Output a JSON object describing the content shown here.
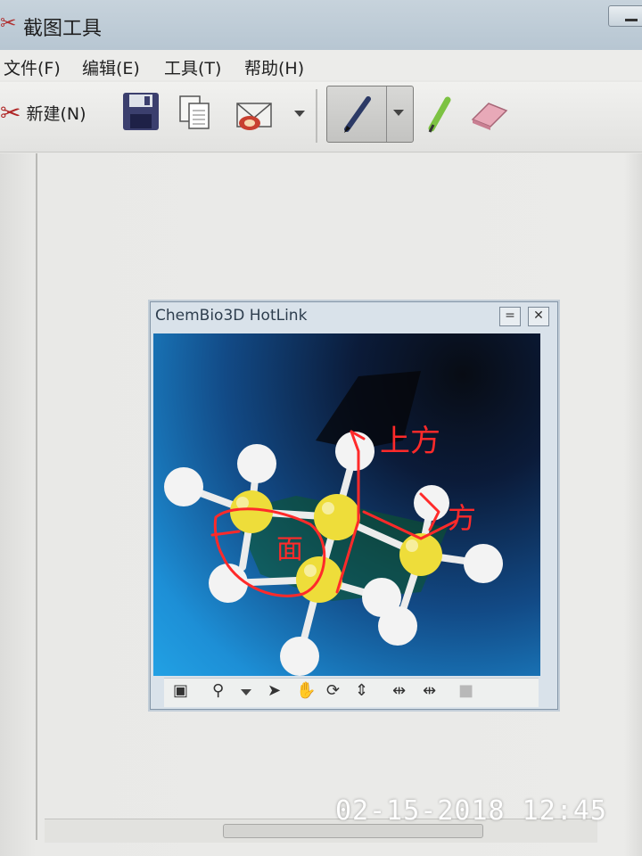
{
  "window": {
    "title": "截图工具"
  },
  "menu": {
    "items": [
      "文件(F)",
      "编辑(E)",
      "工具(T)",
      "帮助(H)"
    ]
  },
  "toolbar": {
    "new_label": "新建(N)"
  },
  "hotlink": {
    "title": "ChemBio3D HotLink"
  },
  "annotations": {
    "top": "上方",
    "right": "方",
    "face": "面"
  },
  "timestamp": "02-15-2018 12:45",
  "colors": {
    "ink": "#ff2a2a",
    "atom_carbon": "#f0e040",
    "atom_hydrogen": "#f4f4f4",
    "bond": "#e9e9e9"
  }
}
